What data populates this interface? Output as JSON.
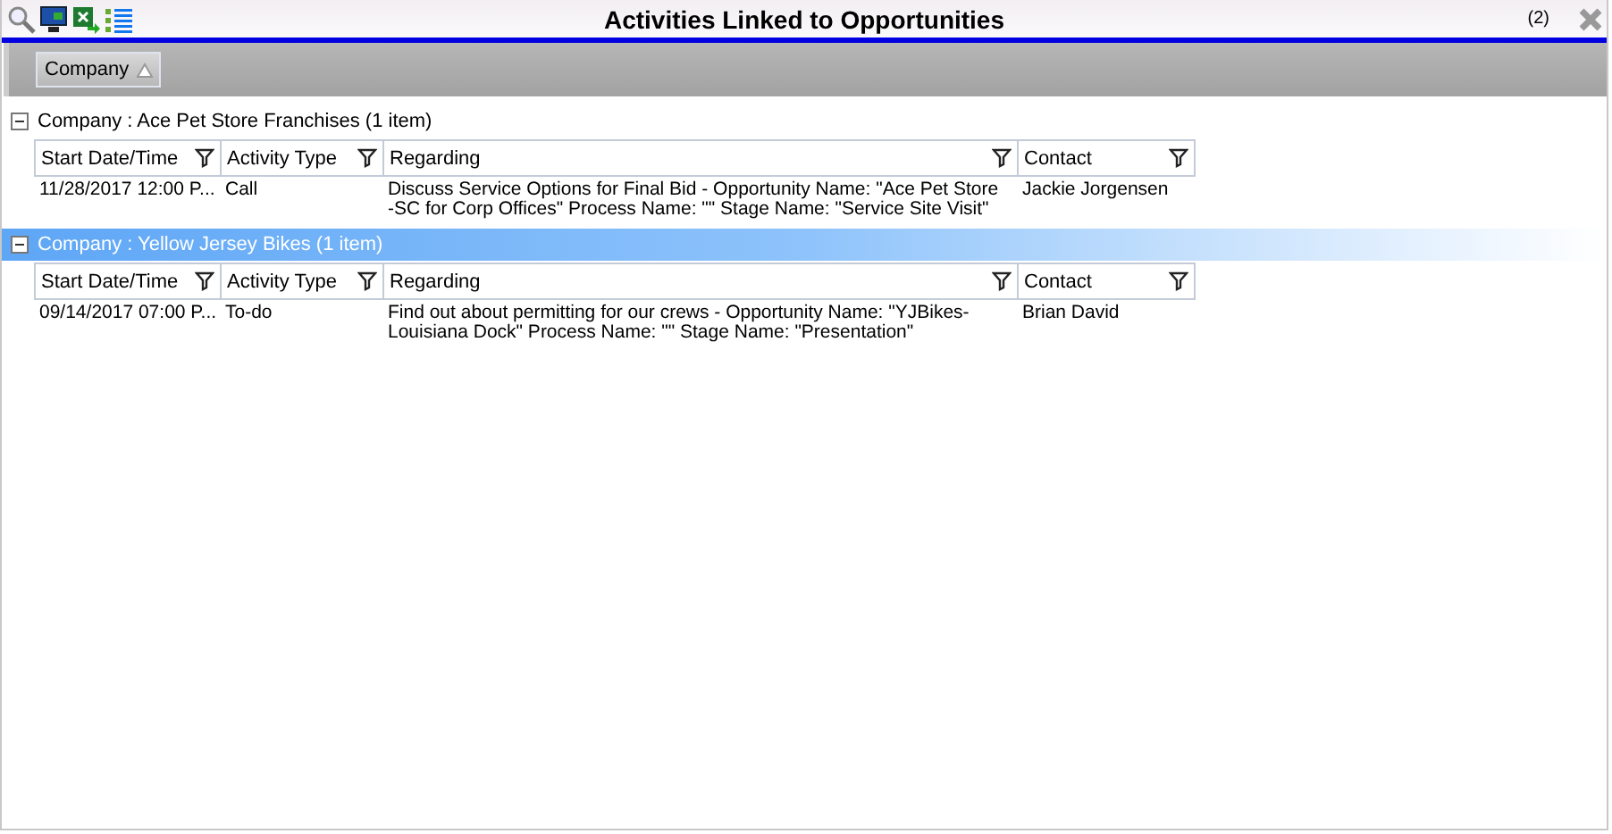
{
  "window": {
    "title": "Activities Linked to Opportunities",
    "count": "(2)"
  },
  "group_by": {
    "chips": [
      {
        "label": "Company",
        "ascending": true
      }
    ]
  },
  "groups": [
    {
      "label": "Company : Ace Pet Store Franchises (1 item)",
      "expanded": true,
      "selected": false,
      "columns": [
        "Start Date/Time",
        "Activity Type",
        "Regarding",
        "Contact"
      ],
      "rows": [
        {
          "start": "11/28/2017 12:00 P...",
          "type": "Call",
          "regarding": [
            "Discuss Service Options for Final Bid - Opportunity Name: \"Ace Pet Store",
            "-SC for Corp Offices\" Process Name: \"\" Stage Name: \"Service Site Visit\""
          ],
          "contact": "Jackie Jorgensen"
        }
      ]
    },
    {
      "label": "Company : Yellow Jersey Bikes (1 item)",
      "expanded": true,
      "selected": true,
      "columns": [
        "Start Date/Time",
        "Activity Type",
        "Regarding",
        "Contact"
      ],
      "rows": [
        {
          "start": "09/14/2017 07:00 P...",
          "type": "To-do",
          "regarding": [
            "Find out about permitting for our crews - Opportunity Name: \"YJBikes-",
            "Louisiana Dock\" Process Name: \"\" Stage Name: \"Presentation\""
          ],
          "contact": "Brian David"
        }
      ]
    }
  ]
}
